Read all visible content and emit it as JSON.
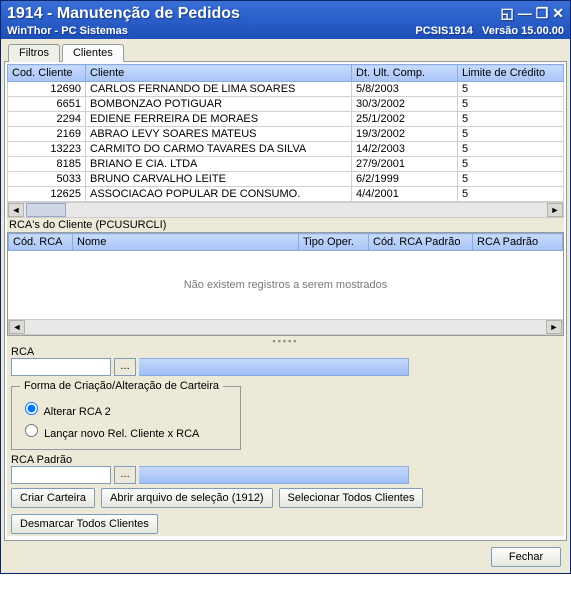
{
  "window": {
    "title": "1914 - Manutenção de Pedidos",
    "product": "WinThor - PC Sistemas",
    "code": "PCSIS1914",
    "version": "Versão 15.00.00"
  },
  "tabs": {
    "filters": "Filtros",
    "clients": "Clientes"
  },
  "clients_grid": {
    "headers": {
      "code": "Cod. Cliente",
      "name": "Cliente",
      "last_purchase": "Dt. Ult. Comp.",
      "credit_limit": "Limite de Crédito"
    },
    "rows": [
      {
        "code": "12690",
        "name": "CARLOS FERNANDO DE LIMA SOARES",
        "date": "5/8/2003",
        "limit": "5"
      },
      {
        "code": "6651",
        "name": "BOMBONZAO POTIGUAR",
        "date": "30/3/2002",
        "limit": "5"
      },
      {
        "code": "2294",
        "name": "EDIENE  FERREIRA DE MORAES",
        "date": "25/1/2002",
        "limit": "5"
      },
      {
        "code": "2169",
        "name": "ABRAO LEVY SOARES MATEUS",
        "date": "19/3/2002",
        "limit": "5"
      },
      {
        "code": "13223",
        "name": "CARMITO DO CARMO TAVARES DA SILVA",
        "date": "14/2/2003",
        "limit": "5"
      },
      {
        "code": "8185",
        "name": "BRIANO E CIA. LTDA",
        "date": "27/9/2001",
        "limit": "5"
      },
      {
        "code": "5033",
        "name": "BRUNO CARVALHO LEITE",
        "date": "6/2/1999",
        "limit": "5"
      },
      {
        "code": "12625",
        "name": "ASSOCIACAO POPULAR DE CONSUMO.",
        "date": "4/4/2001",
        "limit": "5"
      }
    ]
  },
  "rca_section": {
    "title": "RCA's do Cliente (PCUSURCLI)",
    "headers": {
      "code": "Cód. RCA",
      "name": "Nome",
      "oper": "Tipo Oper.",
      "std_code": "Cód. RCA Padrão",
      "std": "RCA Padrão"
    },
    "empty": "Não existem registros a serem mostrados"
  },
  "form": {
    "rca_label": "RCA",
    "rca_value": "",
    "group_legend": "Forma de Criação/Alteração de Carteira",
    "radio1": "Alterar RCA 2",
    "radio2": "Lançar novo Rel. Cliente x RCA",
    "rca_std_label": "RCA Padrão",
    "rca_std_value": ""
  },
  "buttons": {
    "create": "Criar Carteira",
    "open_file": "Abrir arquivo de seleção (1912)",
    "select_all": "Selecionar Todos Clientes",
    "deselect_all": "Desmarcar Todos Clientes",
    "close": "Fechar"
  }
}
